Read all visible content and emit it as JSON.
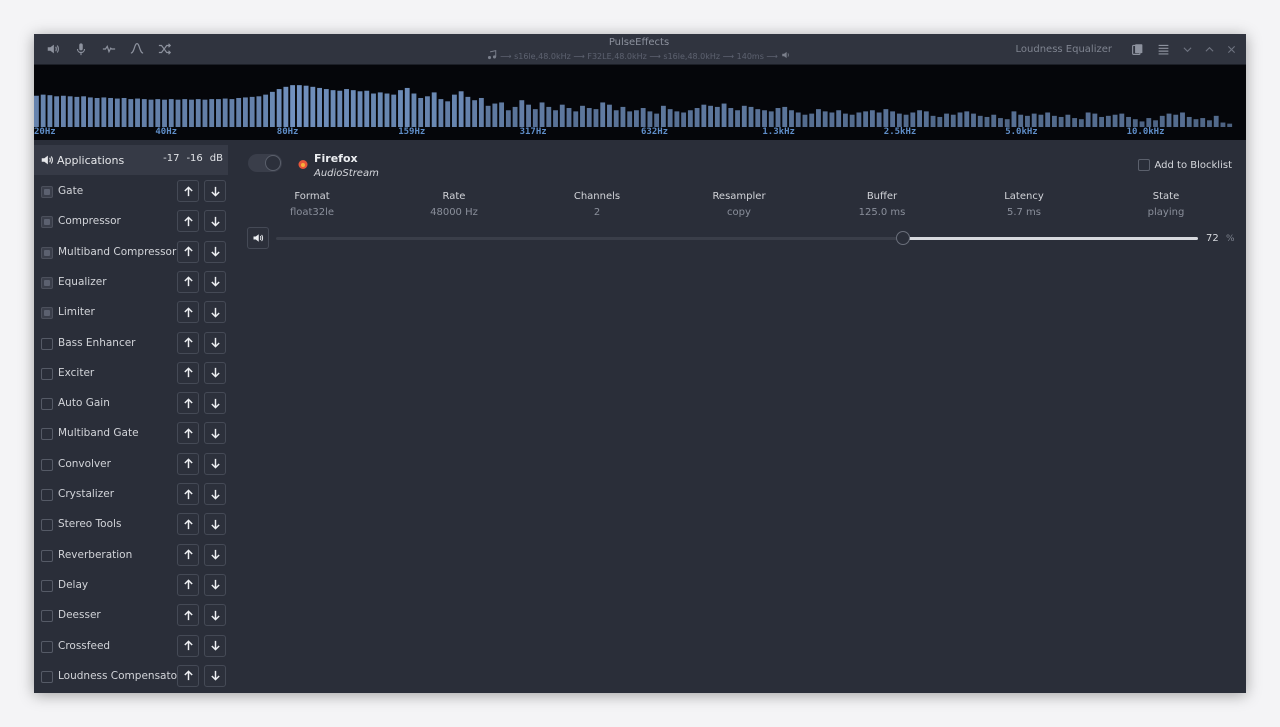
{
  "window": {
    "title": "PulseEffects",
    "pipeline": "⟶ s16le,48.0kHz ⟶ F32LE,48.0kHz ⟶ s16le,48.0kHz ⟶ 140ms ⟶",
    "preset": "Loudness Equalizer"
  },
  "headerbar": {
    "left_icons": [
      "speaker-output-icon",
      "microphone-icon",
      "waveform-icon",
      "curve-icon",
      "shuffle-icon"
    ],
    "right_icons": [
      "presets-icon",
      "menu-icon"
    ],
    "window_controls": [
      "minimize-icon",
      "maximize-icon",
      "close-icon"
    ]
  },
  "spectrum": {
    "bar_color": "#7fa3d6",
    "levels": [
      0.56,
      0.58,
      0.57,
      0.55,
      0.56,
      0.55,
      0.54,
      0.55,
      0.53,
      0.52,
      0.53,
      0.52,
      0.51,
      0.52,
      0.5,
      0.51,
      0.5,
      0.49,
      0.5,
      0.49,
      0.5,
      0.49,
      0.5,
      0.49,
      0.5,
      0.49,
      0.5,
      0.5,
      0.51,
      0.5,
      0.52,
      0.53,
      0.54,
      0.55,
      0.58,
      0.63,
      0.68,
      0.72,
      0.75,
      0.75,
      0.74,
      0.72,
      0.7,
      0.68,
      0.66,
      0.65,
      0.68,
      0.66,
      0.64,
      0.65,
      0.6,
      0.62,
      0.6,
      0.58,
      0.66,
      0.7,
      0.6,
      0.52,
      0.55,
      0.62,
      0.5,
      0.46,
      0.58,
      0.64,
      0.54,
      0.48,
      0.52,
      0.38,
      0.42,
      0.44,
      0.3,
      0.36,
      0.48,
      0.4,
      0.32,
      0.44,
      0.36,
      0.3,
      0.4,
      0.34,
      0.28,
      0.38,
      0.34,
      0.32,
      0.44,
      0.4,
      0.3,
      0.36,
      0.28,
      0.3,
      0.34,
      0.28,
      0.24,
      0.38,
      0.32,
      0.28,
      0.26,
      0.3,
      0.34,
      0.4,
      0.38,
      0.36,
      0.42,
      0.34,
      0.3,
      0.38,
      0.36,
      0.32,
      0.3,
      0.28,
      0.34,
      0.36,
      0.3,
      0.26,
      0.22,
      0.24,
      0.32,
      0.28,
      0.26,
      0.3,
      0.24,
      0.22,
      0.26,
      0.28,
      0.3,
      0.26,
      0.32,
      0.28,
      0.24,
      0.22,
      0.26,
      0.3,
      0.28,
      0.2,
      0.18,
      0.24,
      0.22,
      0.26,
      0.28,
      0.24,
      0.2,
      0.18,
      0.22,
      0.16,
      0.14,
      0.28,
      0.22,
      0.2,
      0.24,
      0.22,
      0.26,
      0.2,
      0.18,
      0.22,
      0.16,
      0.14,
      0.26,
      0.24,
      0.18,
      0.2,
      0.22,
      0.24,
      0.18,
      0.14,
      0.1,
      0.16,
      0.12,
      0.2,
      0.24,
      0.22,
      0.26,
      0.18,
      0.14,
      0.16,
      0.12,
      0.2,
      0.08,
      0.06
    ]
  },
  "freq_axis": [
    "20Hz",
    "40Hz",
    "80Hz",
    "159Hz",
    "317Hz",
    "632Hz",
    "1.3kHz",
    "2.5kHz",
    "5.0kHz",
    "10.0kHz"
  ],
  "sidebar": {
    "applications_label": "Applications",
    "level_left": "-17",
    "level_right": "-16",
    "level_unit": "dB",
    "plugins": [
      {
        "label": "Gate",
        "enabled": true
      },
      {
        "label": "Compressor",
        "enabled": true
      },
      {
        "label": "Multiband Compressor",
        "enabled": true
      },
      {
        "label": "Equalizer",
        "enabled": true
      },
      {
        "label": "Limiter",
        "enabled": true
      },
      {
        "label": "Bass Enhancer",
        "enabled": false
      },
      {
        "label": "Exciter",
        "enabled": false
      },
      {
        "label": "Auto Gain",
        "enabled": false
      },
      {
        "label": "Multiband Gate",
        "enabled": false
      },
      {
        "label": "Convolver",
        "enabled": false
      },
      {
        "label": "Crystalizer",
        "enabled": false
      },
      {
        "label": "Stereo Tools",
        "enabled": false
      },
      {
        "label": "Reverberation",
        "enabled": false
      },
      {
        "label": "Delay",
        "enabled": false
      },
      {
        "label": "Deesser",
        "enabled": false
      },
      {
        "label": "Crossfeed",
        "enabled": false
      },
      {
        "label": "Loudness Compensator",
        "enabled": false
      }
    ]
  },
  "stream": {
    "app_name": "Firefox",
    "subtitle": "AudioStream",
    "app_icon_color": "#e8553a",
    "blocklist_label": "Add to Blocklist",
    "columns": [
      {
        "header": "Format",
        "value": "float32le"
      },
      {
        "header": "Rate",
        "value": "48000 Hz"
      },
      {
        "header": "Channels",
        "value": "2"
      },
      {
        "header": "Resampler",
        "value": "copy"
      },
      {
        "header": "Buffer",
        "value": "125.0 ms"
      },
      {
        "header": "Latency",
        "value": "5.7 ms"
      },
      {
        "header": "State",
        "value": "playing"
      }
    ],
    "volume_value": "72",
    "volume_unit": "%",
    "volume_fraction": 0.72
  }
}
